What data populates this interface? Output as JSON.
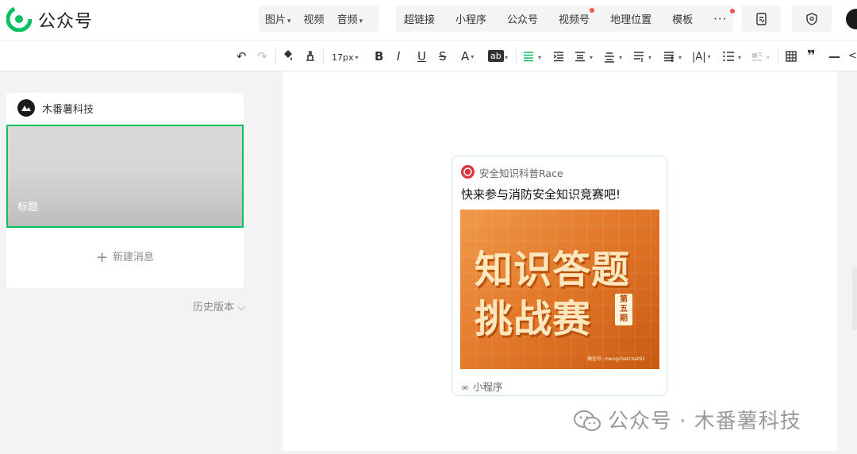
{
  "app": {
    "brand": "公众号"
  },
  "topbar": {
    "group1": [
      {
        "label": "图片",
        "caret": "▾"
      },
      {
        "label": "视频",
        "caret": ""
      },
      {
        "label": "音频",
        "caret": "▾"
      }
    ],
    "group2": [
      {
        "label": "超链接",
        "dot": false
      },
      {
        "label": "小程序",
        "dot": false
      },
      {
        "label": "公众号",
        "dot": false
      },
      {
        "label": "视频号",
        "dot": true
      },
      {
        "label": "地理位置",
        "dot": false
      },
      {
        "label": "模板",
        "dot": false
      }
    ],
    "more": "···",
    "icons": [
      "edit-doc-icon",
      "security-shield-icon",
      "user-avatar"
    ]
  },
  "format_toolbar": {
    "font_size": "17px",
    "icons": [
      "undo-icon",
      "redo-icon",
      "format-painter-icon",
      "clear-format-icon",
      "bold-icon",
      "italic-icon",
      "underline-icon",
      "strikethrough-icon",
      "font-color-icon",
      "background-color-icon",
      "align-icon",
      "indent-icon",
      "line-height-icon",
      "paragraph-spacing-icon",
      "letter-spacing-icon",
      "list-icon",
      "table-icon",
      "quote-icon",
      "divider-icon",
      "code-icon"
    ],
    "glyphs": {
      "undo": "↶",
      "redo": "↷",
      "bold": "B",
      "italic": "I",
      "underline": "U",
      "strike": "S",
      "font_color": "A",
      "bg_color": "ab",
      "letter_spacing": "|A|",
      "quote": "❞",
      "divider": "—",
      "code": "</"
    }
  },
  "left_panel": {
    "account_name": "木番薯科技",
    "cover_title": "标题",
    "new_message": "新建消息",
    "history": "历史版本 ⌵"
  },
  "editor": {
    "mini_program_card": {
      "name": "安全知识科普Race",
      "title": "快来参与消防安全知识竞赛吧!",
      "poster_line1": "知识答题",
      "poster_line2": "挑战赛",
      "poster_badge": [
        "第",
        "五",
        "期"
      ],
      "poster_wechat_id": "微信号: mengchatchat91",
      "footer_label": "小程序"
    }
  },
  "watermark": {
    "text": "公众号 · 木番薯科技"
  },
  "colors": {
    "accent_green": "#07c160",
    "red_dot": "#fa5151",
    "poster_orange": "#e37a2b",
    "poster_text": "#ffe7bd",
    "link_blue": "#576b95"
  }
}
